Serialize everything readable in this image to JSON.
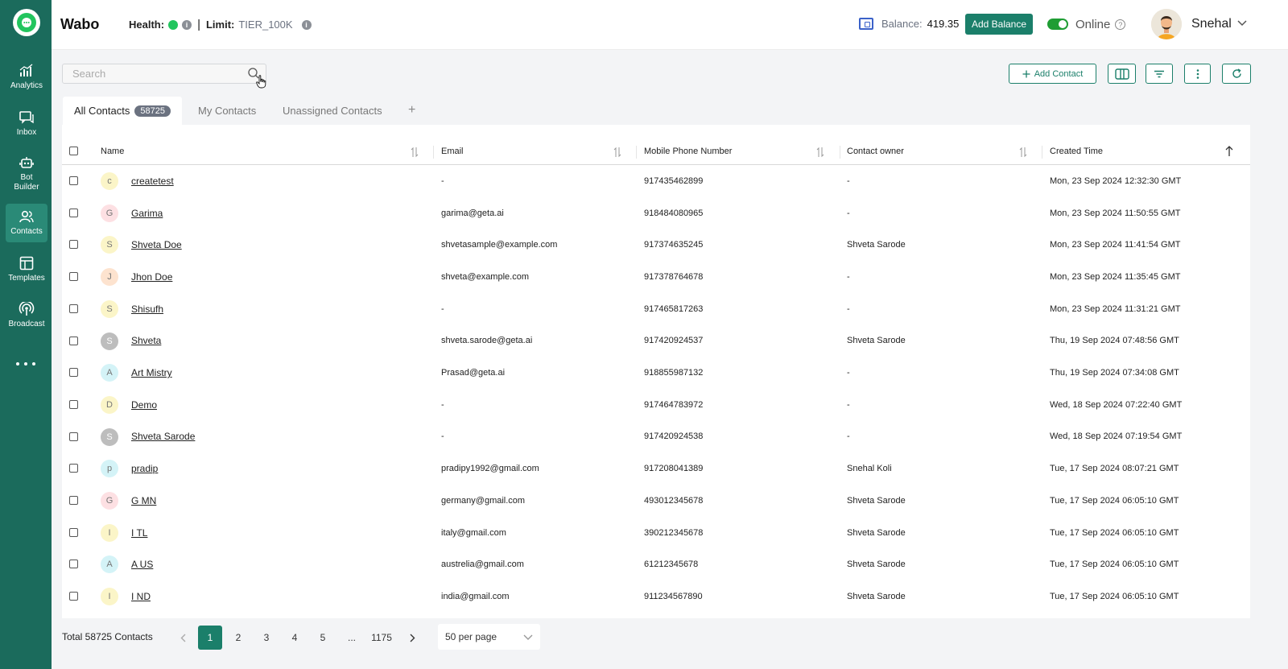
{
  "sidebar": {
    "items": [
      {
        "label": "Analytics",
        "icon": "analytics-icon"
      },
      {
        "label": "Inbox",
        "icon": "inbox-icon"
      },
      {
        "label": "Bot Builder",
        "icon": "bot-icon"
      },
      {
        "label": "Contacts",
        "icon": "contacts-icon",
        "active": true
      },
      {
        "label": "Templates",
        "icon": "templates-icon"
      },
      {
        "label": "Broadcast",
        "icon": "broadcast-icon"
      }
    ]
  },
  "header": {
    "brand": "Wabo",
    "health_label": "Health:",
    "separator": "|",
    "limit_label": "Limit:",
    "limit_value": "TIER_100K",
    "balance_label": "Balance:",
    "balance_value": "419.35",
    "add_balance_label": "Add Balance",
    "status_label": "Online",
    "user_name": "Snehal"
  },
  "toolbar": {
    "search_placeholder": "Search",
    "add_contact_label": "Add Contact"
  },
  "tabs": {
    "all_contacts": "All Contacts",
    "all_count": "58725",
    "my_contacts": "My Contacts",
    "unassigned_contacts": "Unassigned Contacts",
    "add_tab": "+"
  },
  "table": {
    "columns": {
      "name": "Name",
      "email": "Email",
      "phone": "Mobile Phone Number",
      "owner": "Contact owner",
      "created": "Created Time"
    },
    "rows": [
      {
        "initial": "c",
        "name": "createtest",
        "email": "-",
        "phone": "917435462899",
        "owner": "-",
        "created": "Mon, 23 Sep 2024 12:32:30 GMT",
        "color": "#fbf5c8"
      },
      {
        "initial": "G",
        "name": "Garima",
        "email": "garima@geta.ai",
        "phone": "918484080965",
        "owner": "-",
        "created": "Mon, 23 Sep 2024 11:50:55 GMT",
        "color": "#fde0e3"
      },
      {
        "initial": "S",
        "name": "Shveta Doe",
        "email": "shvetasample@example.com",
        "phone": "917374635245",
        "owner": "Shveta Sarode",
        "created": "Mon, 23 Sep 2024 11:41:54 GMT",
        "color": "#fbf5c8"
      },
      {
        "initial": "J",
        "name": "Jhon Doe",
        "email": "shveta@example.com",
        "phone": "917378764678",
        "owner": "-",
        "created": "Mon, 23 Sep 2024 11:35:45 GMT",
        "color": "#fde3cf"
      },
      {
        "initial": "S",
        "name": "Shisufh",
        "email": "-",
        "phone": "917465817263",
        "owner": "-",
        "created": "Mon, 23 Sep 2024 11:31:21 GMT",
        "color": "#fbf5c8"
      },
      {
        "initial": "S",
        "name": "Shveta",
        "email": "shveta.sarode@geta.ai",
        "phone": "917420924537",
        "owner": "Shveta Sarode",
        "created": "Thu, 19 Sep 2024 07:48:56 GMT",
        "color": "#bdbdbd"
      },
      {
        "initial": "A",
        "name": "Art Mistry",
        "email": "Prasad@geta.ai",
        "phone": "918855987132",
        "owner": "-",
        "created": "Thu, 19 Sep 2024 07:34:08 GMT",
        "color": "#d4f3f7"
      },
      {
        "initial": "D",
        "name": "Demo",
        "email": "-",
        "phone": "917464783972",
        "owner": "-",
        "created": "Wed, 18 Sep 2024 07:22:40 GMT",
        "color": "#fbf5c8"
      },
      {
        "initial": "S",
        "name": "Shveta Sarode",
        "email": "-",
        "phone": "917420924538",
        "owner": "-",
        "created": "Wed, 18 Sep 2024 07:19:54 GMT",
        "color": "#bdbdbd"
      },
      {
        "initial": "p",
        "name": "pradip",
        "email": "pradipy1992@gmail.com",
        "phone": "917208041389",
        "owner": "Snehal Koli",
        "created": "Tue, 17 Sep 2024 08:07:21 GMT",
        "color": "#d4f3f7"
      },
      {
        "initial": "G",
        "name": "G MN",
        "email": "germany@gmail.com",
        "phone": "493012345678",
        "owner": "Shveta Sarode",
        "created": "Tue, 17 Sep 2024 06:05:10 GMT",
        "color": "#fde0e3"
      },
      {
        "initial": "I",
        "name": "I TL",
        "email": "italy@gmail.com",
        "phone": "390212345678",
        "owner": "Shveta Sarode",
        "created": "Tue, 17 Sep 2024 06:05:10 GMT",
        "color": "#fbf5c8"
      },
      {
        "initial": "A",
        "name": "A US",
        "email": "austrelia@gmail.com",
        "phone": "61212345678",
        "owner": "Shveta Sarode",
        "created": "Tue, 17 Sep 2024 06:05:10 GMT",
        "color": "#d4f3f7"
      },
      {
        "initial": "I",
        "name": "I ND",
        "email": "india@gmail.com",
        "phone": "911234567890",
        "owner": "Shveta Sarode",
        "created": "Tue, 17 Sep 2024 06:05:10 GMT",
        "color": "#fbf5c8"
      }
    ]
  },
  "footer": {
    "total_label": "Total 58725 Contacts",
    "pages": [
      "1",
      "2",
      "3",
      "4",
      "5",
      "...",
      "1175"
    ],
    "current_page": "1",
    "per_page": "50 per page"
  },
  "colors": {
    "sidebar": "#1b6b5c",
    "accent": "#1b7f6a",
    "online_toggle": "#1f9d34"
  }
}
